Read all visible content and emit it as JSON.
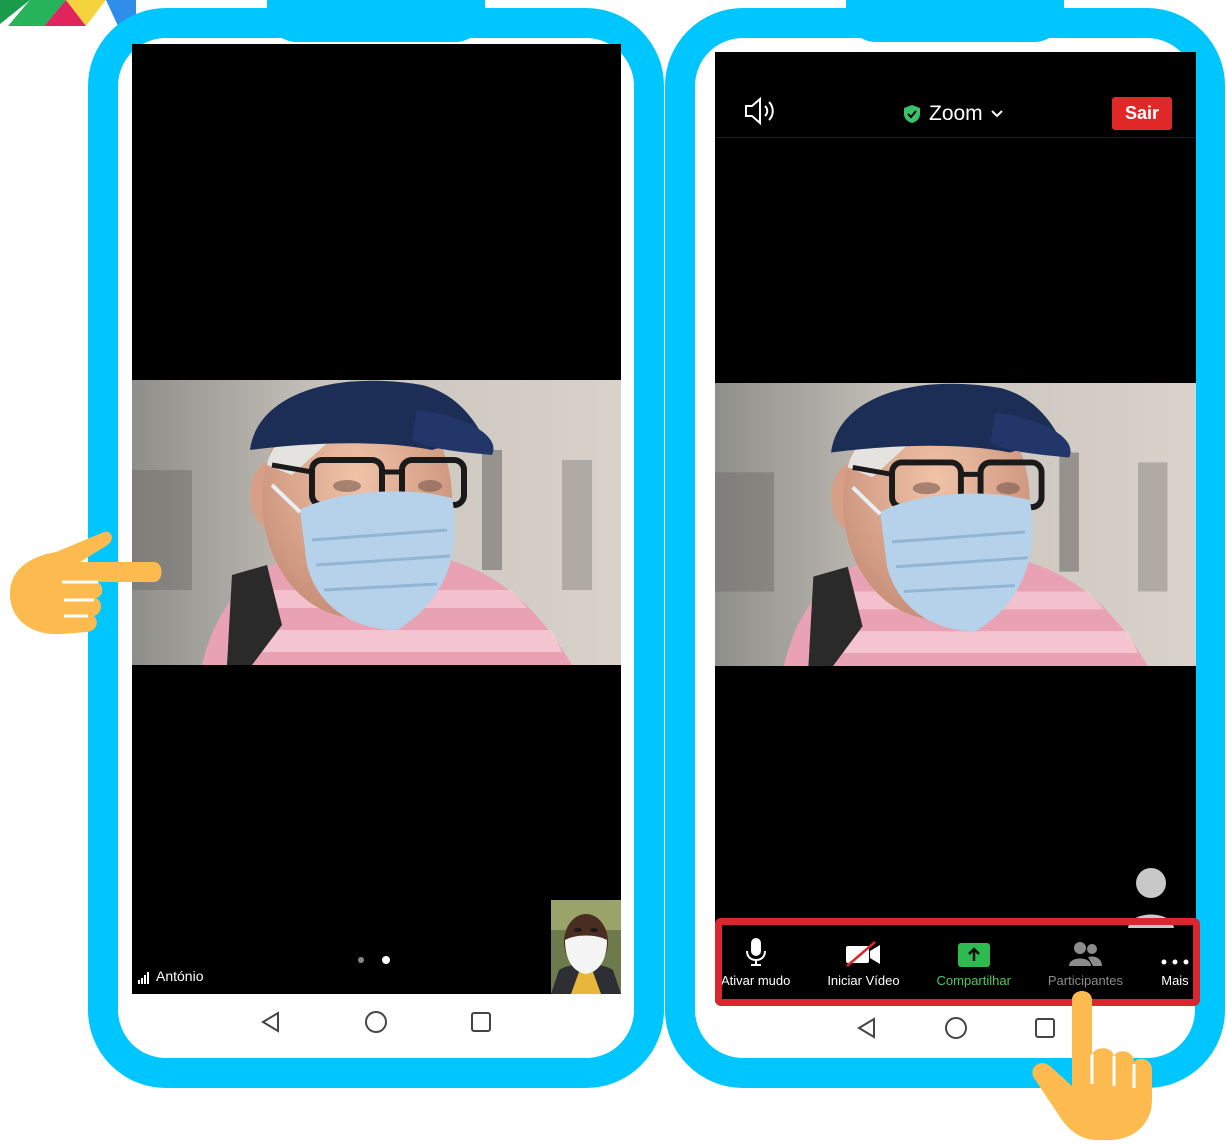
{
  "colors": {
    "frame": "#00c6ff",
    "leave_button": "#e02828",
    "share_green": "#4ccb5b",
    "highlight_red": "#d9262f",
    "hand": "#fdbb4f"
  },
  "left_phone": {
    "participant_name": "António",
    "page_indicator": {
      "pages": 2,
      "active": 2
    },
    "nav": [
      "back-icon",
      "home-icon",
      "recents-icon"
    ]
  },
  "right_phone": {
    "topbar": {
      "speaker_icon": "speaker-icon",
      "meeting_title": "Zoom",
      "leave_label": "Sair"
    },
    "toolbar": {
      "items": [
        {
          "label": "Ativar mudo",
          "icon": "microphone-icon"
        },
        {
          "label": "Iniciar Vídeo",
          "icon": "video-off-icon"
        },
        {
          "label": "Compartilhar",
          "icon": "share-screen-icon"
        },
        {
          "label": "Participantes",
          "icon": "participants-icon"
        },
        {
          "label": "Mais",
          "icon": "more-icon"
        }
      ]
    },
    "nav": [
      "back-icon",
      "home-icon",
      "recents-icon"
    ]
  }
}
